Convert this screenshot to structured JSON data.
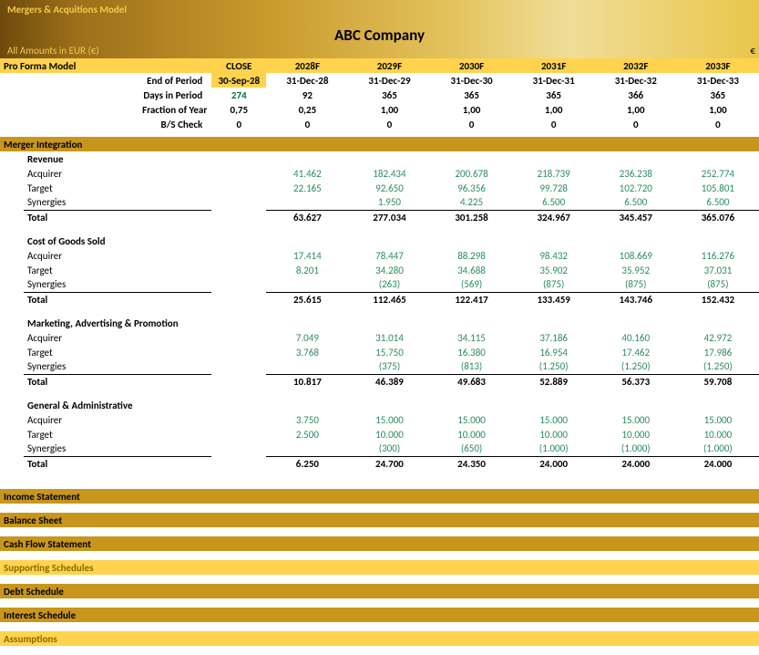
{
  "header": {
    "model_title": "Mergers & Acquitions Model",
    "company": "ABC Company",
    "currency_label": "All Amounts in EUR (€)",
    "currency_sym": "€"
  },
  "table_header": {
    "proforma": "Pro Forma Model",
    "close": "CLOSE",
    "years": [
      "2028F",
      "2029F",
      "2030F",
      "2031F",
      "2032F",
      "2033F"
    ]
  },
  "period_rows": {
    "eop": {
      "label": "End of Period",
      "close": "30-Sep-28",
      "v": [
        "31-Dec-28",
        "31-Dec-29",
        "31-Dec-30",
        "31-Dec-31",
        "31-Dec-32",
        "31-Dec-33"
      ]
    },
    "days": {
      "label": "Days in Period",
      "close": "274",
      "v": [
        "92",
        "365",
        "365",
        "365",
        "366",
        "365"
      ]
    },
    "frac": {
      "label": "Fraction of Year",
      "close": "0,75",
      "v": [
        "0,25",
        "1,00",
        "1,00",
        "1,00",
        "1,00",
        "1,00"
      ]
    },
    "bs": {
      "label": "B/S Check",
      "close": "0",
      "v": [
        "0",
        "0",
        "0",
        "0",
        "0",
        "0"
      ]
    }
  },
  "sections": {
    "merger": "Merger Integration",
    "income": "Income Statement",
    "balance": "Balance Sheet",
    "cashflow": "Cash Flow Statement",
    "support": "Supporting Schedules",
    "debt": "Debt Schedule",
    "interest": "Interest Schedule",
    "assumptions": "Assumptions"
  },
  "groups": [
    {
      "title": "Revenue",
      "rows": [
        {
          "label": "Acquirer",
          "v": [
            "41.462",
            "182.434",
            "200.678",
            "218.739",
            "236.238",
            "252.774"
          ]
        },
        {
          "label": "Target",
          "v": [
            "22.165",
            "92.650",
            "96.356",
            "99.728",
            "102.720",
            "105.801"
          ]
        },
        {
          "label": "Synergies",
          "v": [
            "",
            "1.950",
            "4.225",
            "6.500",
            "6.500",
            "6.500"
          ]
        }
      ],
      "total": {
        "label": "Total",
        "v": [
          "63.627",
          "277.034",
          "301.258",
          "324.967",
          "345.457",
          "365.076"
        ]
      }
    },
    {
      "title": "Cost of Goods Sold",
      "rows": [
        {
          "label": "Acquirer",
          "v": [
            "17.414",
            "78.447",
            "88.298",
            "98.432",
            "108.669",
            "116.276"
          ]
        },
        {
          "label": "Target",
          "v": [
            "8.201",
            "34.280",
            "34.688",
            "35.902",
            "35.952",
            "37.031"
          ]
        },
        {
          "label": "Synergies",
          "v": [
            "",
            "(263)",
            "(569)",
            "(875)",
            "(875)",
            "(875)"
          ]
        }
      ],
      "total": {
        "label": "Total",
        "v": [
          "25.615",
          "112.465",
          "122.417",
          "133.459",
          "143.746",
          "152.432"
        ]
      }
    },
    {
      "title": "Marketing, Advertising & Promotion",
      "rows": [
        {
          "label": "Acquirer",
          "v": [
            "7.049",
            "31.014",
            "34.115",
            "37.186",
            "40.160",
            "42.972"
          ]
        },
        {
          "label": "Target",
          "v": [
            "3.768",
            "15.750",
            "16.380",
            "16.954",
            "17.462",
            "17.986"
          ]
        },
        {
          "label": "Synergies",
          "v": [
            "",
            "(375)",
            "(813)",
            "(1.250)",
            "(1.250)",
            "(1.250)"
          ]
        }
      ],
      "total": {
        "label": "Total",
        "v": [
          "10.817",
          "46.389",
          "49.683",
          "52.889",
          "56.373",
          "59.708"
        ]
      }
    },
    {
      "title": "General & Administrative",
      "rows": [
        {
          "label": "Acquirer",
          "v": [
            "3.750",
            "15.000",
            "15.000",
            "15.000",
            "15.000",
            "15.000"
          ]
        },
        {
          "label": "Target",
          "v": [
            "2.500",
            "10.000",
            "10.000",
            "10.000",
            "10.000",
            "10.000"
          ]
        },
        {
          "label": "Synergies",
          "v": [
            "",
            "(300)",
            "(650)",
            "(1.000)",
            "(1.000)",
            "(1.000)"
          ]
        }
      ],
      "total": {
        "label": "Total",
        "v": [
          "6.250",
          "24.700",
          "24.350",
          "24.000",
          "24.000",
          "24.000"
        ]
      }
    }
  ]
}
